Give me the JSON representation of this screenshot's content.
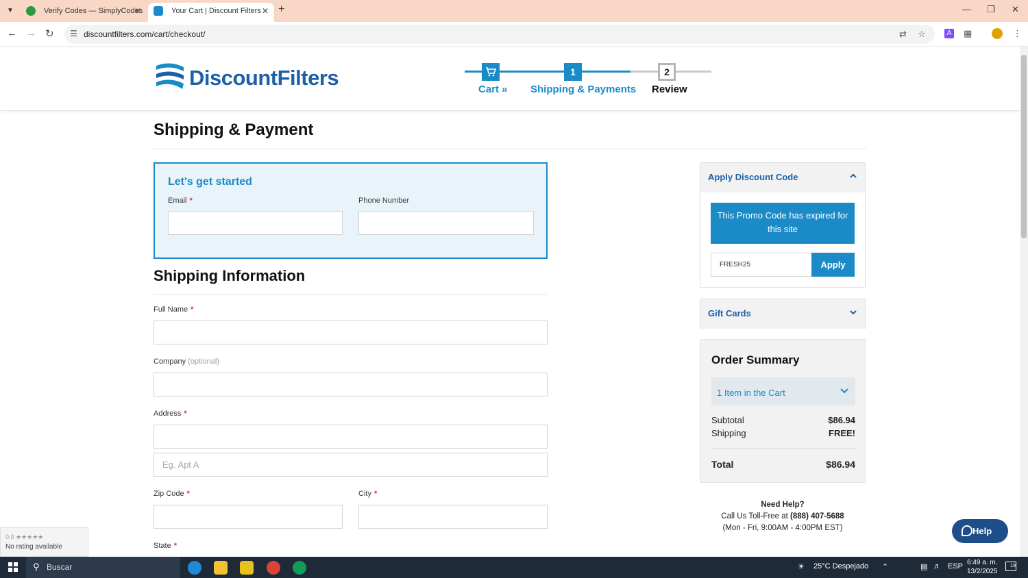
{
  "browser": {
    "tabs": [
      {
        "title": "Verify Codes — SimplyCodes"
      },
      {
        "title": "Your Cart | Discount Filters"
      }
    ],
    "url": "discountfilters.com/cart/checkout/"
  },
  "header": {
    "logo_text": "DiscountFilters",
    "steps": [
      {
        "label": "Cart »",
        "marker": ""
      },
      {
        "label": "Shipping & Payments",
        "marker": "1"
      },
      {
        "label": "Review",
        "marker": "2"
      }
    ]
  },
  "page": {
    "title": "Shipping & Payment",
    "contact": {
      "heading": "Let's get started",
      "email_label": "Email",
      "phone_label": "Phone Number"
    },
    "shipping": {
      "heading": "Shipping Information",
      "full_name_label": "Full Name",
      "company_label": "Company",
      "company_optional": "(optional)",
      "address_label": "Address",
      "address2_placeholder": "Eg. Apt A",
      "zip_label": "Zip Code",
      "city_label": "City",
      "state_label": "State"
    }
  },
  "sidebar": {
    "discount": {
      "heading": "Apply Discount Code",
      "message": "This Promo Code has expired for this site",
      "code_value": "FRESH25",
      "apply_label": "Apply"
    },
    "gift_cards": {
      "heading": "Gift Cards"
    },
    "summary": {
      "heading": "Order Summary",
      "items_label": "1 Item in the Cart",
      "subtotal_label": "Subtotal",
      "subtotal_value": "$86.94",
      "shipping_label": "Shipping",
      "shipping_value": "FREE!",
      "total_label": "Total",
      "total_value": "$86.94"
    },
    "help": {
      "title": "Need Help?",
      "line1_prefix": "Call Us Toll-Free at ",
      "phone": "(888) 407-5688",
      "hours": "(Mon - Fri, 9:00AM - 4:00PM EST)"
    }
  },
  "help_button": {
    "label": "Help"
  },
  "rating_widget": {
    "score": "0.0 ★★★★★",
    "text": "No rating available"
  },
  "taskbar": {
    "search_label": "Buscar",
    "weather": "25°C  Despejado",
    "language": "ESP",
    "time": "6:49 a. m.",
    "date": "13/2/2025",
    "notifications": "19"
  },
  "colors": {
    "brand_blue": "#1a8bc7",
    "brand_navy": "#1d5fa8",
    "help_navy": "#1d4e89"
  }
}
